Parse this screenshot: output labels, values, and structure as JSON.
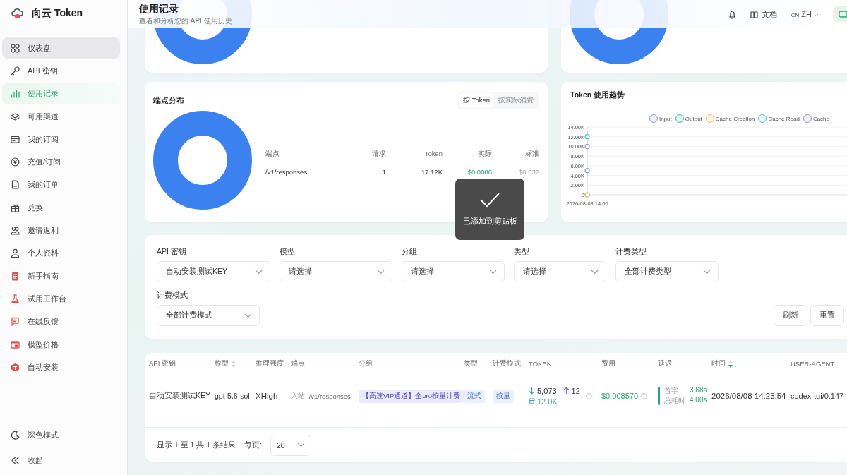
{
  "app": {
    "name": "向云 Token"
  },
  "sidebar": {
    "items": [
      {
        "label": "仪表盘",
        "selected": false,
        "hovered": true
      },
      {
        "label": "API 密钥",
        "selected": false,
        "hovered": false
      },
      {
        "label": "使用记录",
        "selected": true,
        "hovered": false
      },
      {
        "label": "可用渠道",
        "selected": false,
        "hovered": false
      },
      {
        "label": "我的订阅",
        "selected": false,
        "hovered": false
      },
      {
        "label": "充值/订阅",
        "selected": false,
        "hovered": false
      },
      {
        "label": "我的订单",
        "selected": false,
        "hovered": false
      },
      {
        "label": "兑换",
        "selected": false,
        "hovered": false
      },
      {
        "label": "邀请返利",
        "selected": false,
        "hovered": false
      },
      {
        "label": "个人资料",
        "selected": false,
        "hovered": false
      },
      {
        "label": "新手指南",
        "selected": false,
        "hovered": false
      },
      {
        "label": "试用工作台",
        "selected": false,
        "hovered": false
      },
      {
        "label": "在线反馈",
        "selected": false,
        "hovered": false
      },
      {
        "label": "模型价格",
        "selected": false,
        "hovered": false
      },
      {
        "label": "自动安装",
        "selected": false,
        "hovered": false
      }
    ],
    "footer": [
      {
        "label": "深色模式"
      },
      {
        "label": "收起"
      }
    ]
  },
  "header": {
    "title": "使用记录",
    "subtitle": "查看和分析您的 API 使用历史",
    "docs": "文档",
    "lang_flag": "CN",
    "lang": "ZH"
  },
  "endpoint_card": {
    "title": "端点分布",
    "toggle": [
      {
        "label": "按 Token",
        "selected": true
      },
      {
        "label": "按实际消费",
        "selected": false
      }
    ],
    "columns": [
      "端点",
      "请求",
      "Token",
      "实际",
      "标准"
    ],
    "rows": [
      {
        "endpoint": "/v1/responses",
        "requests": "1",
        "tokens": "17.12K",
        "actual": "$0.0086",
        "standard": "$0.032"
      }
    ]
  },
  "trend_card": {
    "title": "Token 使用趋势",
    "chart_data": {
      "type": "line",
      "x": [
        "2026-08-08 14:00"
      ],
      "series": [
        {
          "name": "Input",
          "color": "#8e9ade",
          "values": [
            5000
          ],
          "marker": true
        },
        {
          "name": "Output",
          "color": "#3cbf8e",
          "values": [
            0
          ],
          "marker": true
        },
        {
          "name": "Cache Creation",
          "color": "#f0bf55",
          "values": [
            0
          ],
          "marker": true
        },
        {
          "name": "Cache Read",
          "color": "#4fc4b4",
          "values": [
            12000
          ],
          "marker": true
        },
        {
          "name": "Cache",
          "color": "#a08fdc",
          "values": [
            10000
          ],
          "marker": true
        }
      ],
      "grid": true,
      "ylim": [
        0,
        14000
      ],
      "yticks": [
        {
          "value": 0,
          "label": "0"
        },
        {
          "value": 2000,
          "label": "2.00K"
        },
        {
          "value": 4000,
          "label": "4.00K"
        },
        {
          "value": 6000,
          "label": "6.00K"
        },
        {
          "value": 8000,
          "label": "8.00K"
        },
        {
          "value": 10000,
          "label": "10.00K"
        },
        {
          "value": 12000,
          "label": "12.00K"
        },
        {
          "value": 14000,
          "label": "14.00K"
        }
      ]
    }
  },
  "toast": {
    "message": "已添加到剪贴板"
  },
  "filters": [
    {
      "label": "API 密钥",
      "value": "自动安装测试KEY"
    },
    {
      "label": "模型",
      "value": "请选择"
    },
    {
      "label": "分组",
      "value": "请选择"
    },
    {
      "label": "类型",
      "value": "请选择"
    },
    {
      "label": "计费类型",
      "value": "全部计费类型"
    },
    {
      "label": "计费模式",
      "value": "全部计费模式"
    }
  ],
  "filter_buttons": [
    "刷新",
    "重置"
  ],
  "table": {
    "columns": [
      {
        "label": "API 密钥"
      },
      {
        "label": "模型",
        "sortable": true,
        "sorted": false
      },
      {
        "label": "推理强度"
      },
      {
        "label": "端点"
      },
      {
        "label": "分组"
      },
      {
        "label": "类型"
      },
      {
        "label": "计费模式"
      },
      {
        "label": "TOKEN"
      },
      {
        "label": "费用"
      },
      {
        "label": "延迟"
      },
      {
        "label": "时间",
        "sortable": true,
        "sorted": true
      },
      {
        "label": "USER-AGENT"
      }
    ],
    "rows": [
      {
        "api_key": "自动安装测试KEY",
        "model": "gpt-5.6-sol",
        "reasoning": "XHigh",
        "endpoint_label": "入站:",
        "endpoint": "/v1/responses",
        "group": "【高速VIP通道】全pro按量计费",
        "type": "流式",
        "billing_mode": "按量",
        "input_tokens": "5,073",
        "output_tokens": "12",
        "cache_tokens": "12.0K",
        "cost": "$0.008570",
        "first_token_label": "首字",
        "first_token": "3.68s",
        "total_label": "总耗时",
        "total": "4.00s",
        "time": "2026/08/08 14:23:54",
        "user_agent": "codex-tui/0.147"
      }
    ]
  },
  "pagination": {
    "summary": "显示 1 至 1 共 1 条结果",
    "per_page_label": "每页:",
    "per_page": "20"
  }
}
